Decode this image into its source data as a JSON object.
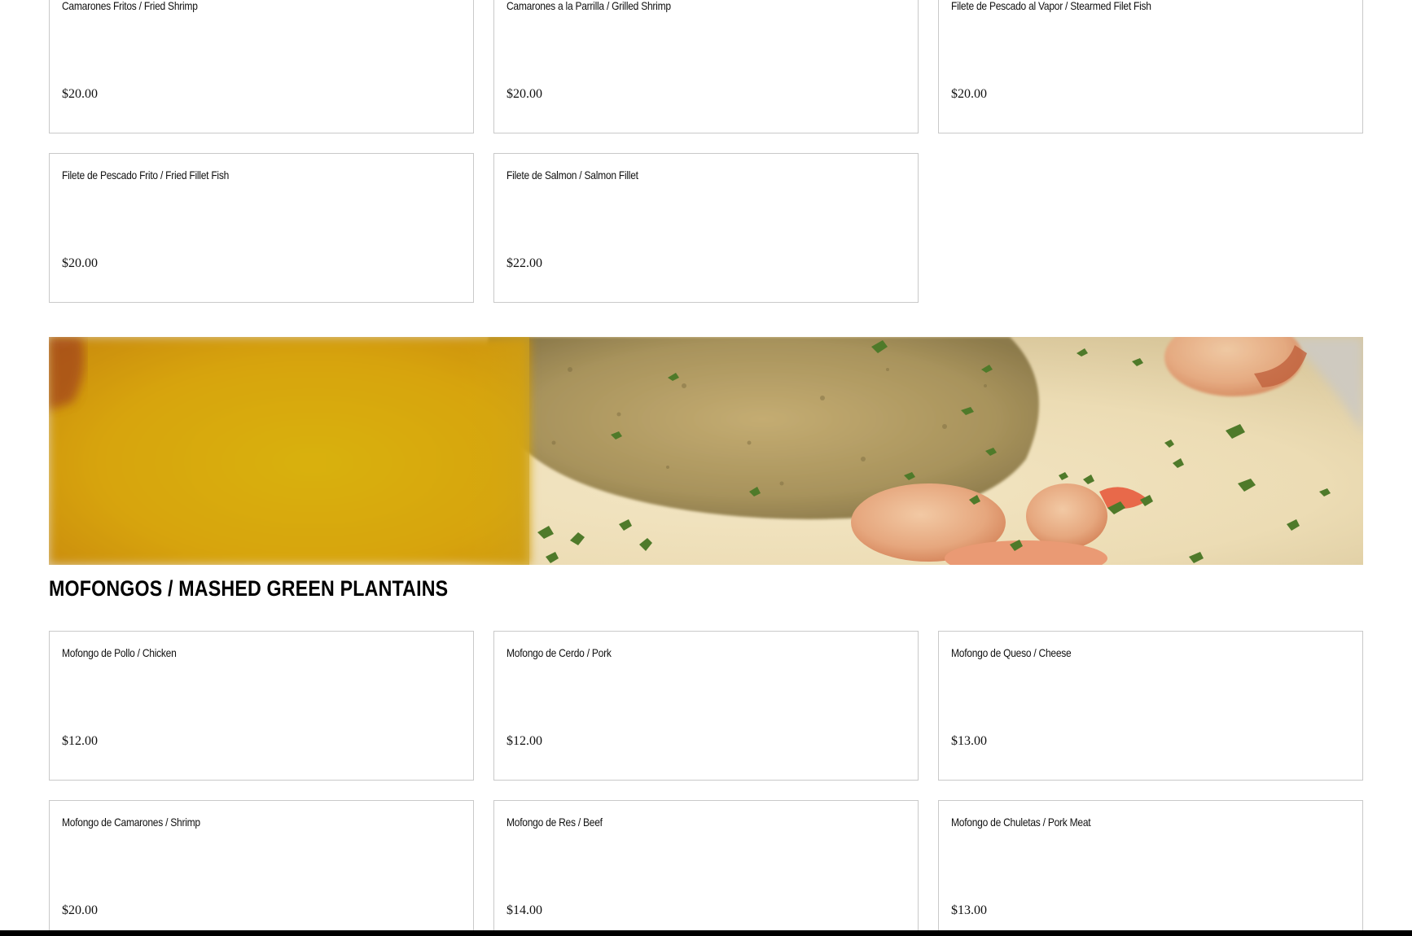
{
  "seafood_items": [
    {
      "name": "Camarones Fritos / Fried Shrimp",
      "price": "$20.00"
    },
    {
      "name": "Camarones a la Parrilla / Grilled Shrimp",
      "price": "$20.00"
    },
    {
      "name": "Filete de Pescado al Vapor / Stearmed Filet Fish",
      "price": "$20.00"
    },
    {
      "name": "Filete de Pescado Frito / Fried Fillet Fish",
      "price": "$20.00"
    },
    {
      "name": "Filete de Salmon / Salmon Fillet",
      "price": "$22.00"
    }
  ],
  "mofongos": {
    "title": "MOFONGOS / MASHED GREEN PLANTAINS",
    "items": [
      {
        "name": "Mofongo de Pollo / Chicken",
        "price": "$12.00"
      },
      {
        "name": "Mofongo de Cerdo / Pork",
        "price": "$12.00"
      },
      {
        "name": "Mofongo de Queso / Cheese",
        "price": "$13.00"
      },
      {
        "name": "Mofongo de Camarones / Shrimp",
        "price": "$20.00"
      },
      {
        "name": "Mofongo de Res / Beef",
        "price": "$14.00"
      },
      {
        "name": "Mofongo de Chuletas / Pork Meat",
        "price": "$13.00"
      }
    ]
  },
  "banner": {
    "icon": "mofongo-photo"
  },
  "colors": {
    "card_border": "#c9c9c9",
    "text": "#111111",
    "background": "#ffffff"
  }
}
